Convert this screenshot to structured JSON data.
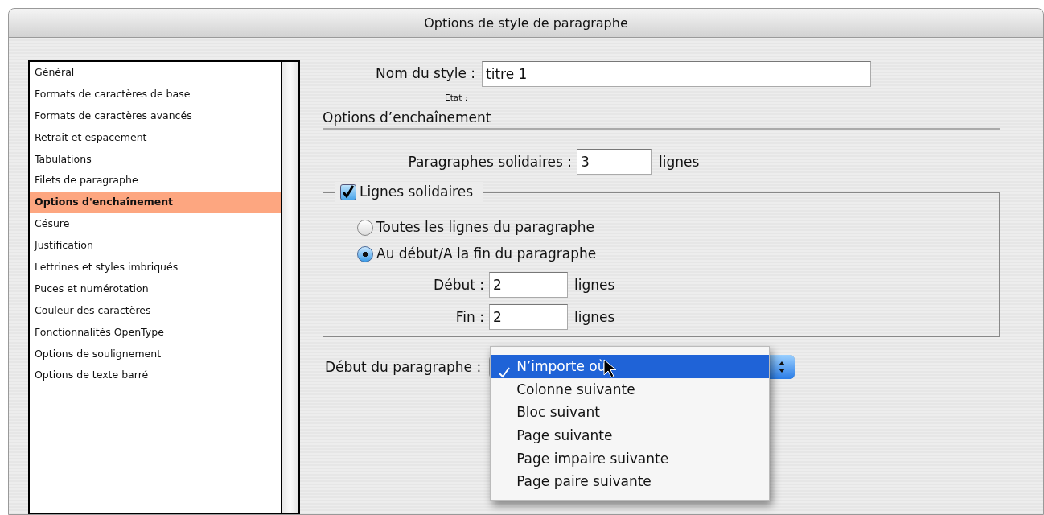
{
  "window": {
    "title": "Options de style de paragraphe"
  },
  "sidebar": {
    "items": [
      {
        "label": "Général",
        "selected": false
      },
      {
        "label": "Formats de caractères de base",
        "selected": false
      },
      {
        "label": "Formats de caractères avancés",
        "selected": false
      },
      {
        "label": "Retrait et espacement",
        "selected": false
      },
      {
        "label": "Tabulations",
        "selected": false
      },
      {
        "label": "Filets de paragraphe",
        "selected": false
      },
      {
        "label": "Options d'enchaînement",
        "selected": true
      },
      {
        "label": "Césure",
        "selected": false
      },
      {
        "label": "Justification",
        "selected": false
      },
      {
        "label": "Lettrines et styles imbriqués",
        "selected": false
      },
      {
        "label": "Puces et numérotation",
        "selected": false
      },
      {
        "label": "Couleur des caractères",
        "selected": false
      },
      {
        "label": "Fonctionnalités OpenType",
        "selected": false
      },
      {
        "label": "Options de soulignement",
        "selected": false
      },
      {
        "label": "Options de texte barré",
        "selected": false
      }
    ]
  },
  "style_name": {
    "label": "Nom du style :",
    "value": "titre 1"
  },
  "state_label": "Etat :",
  "section_title": "Options d’enchaînement",
  "keep_with_next": {
    "label": "Paragraphes solidaires :",
    "value": "3",
    "unit": "lignes"
  },
  "keep_lines": {
    "label": "Lignes solidaires",
    "checked": true,
    "options": [
      {
        "label": "Toutes les lignes du paragraphe",
        "selected": false
      },
      {
        "label": "Au début/A la fin du paragraphe",
        "selected": true
      }
    ],
    "fields": [
      {
        "label": "Début :",
        "value": "2",
        "unit": "lignes"
      },
      {
        "label": "Fin :",
        "value": "2",
        "unit": "lignes"
      }
    ]
  },
  "paragraph_start": {
    "label": "Début du paragraphe :",
    "menu": [
      {
        "label": "N’importe où",
        "selected": true
      },
      {
        "label": "Colonne suivante",
        "selected": false
      },
      {
        "label": "Bloc suivant",
        "selected": false
      },
      {
        "label": "Page suivante",
        "selected": false
      },
      {
        "label": "Page impaire suivante",
        "selected": false
      },
      {
        "label": "Page paire suivante",
        "selected": false
      }
    ]
  }
}
